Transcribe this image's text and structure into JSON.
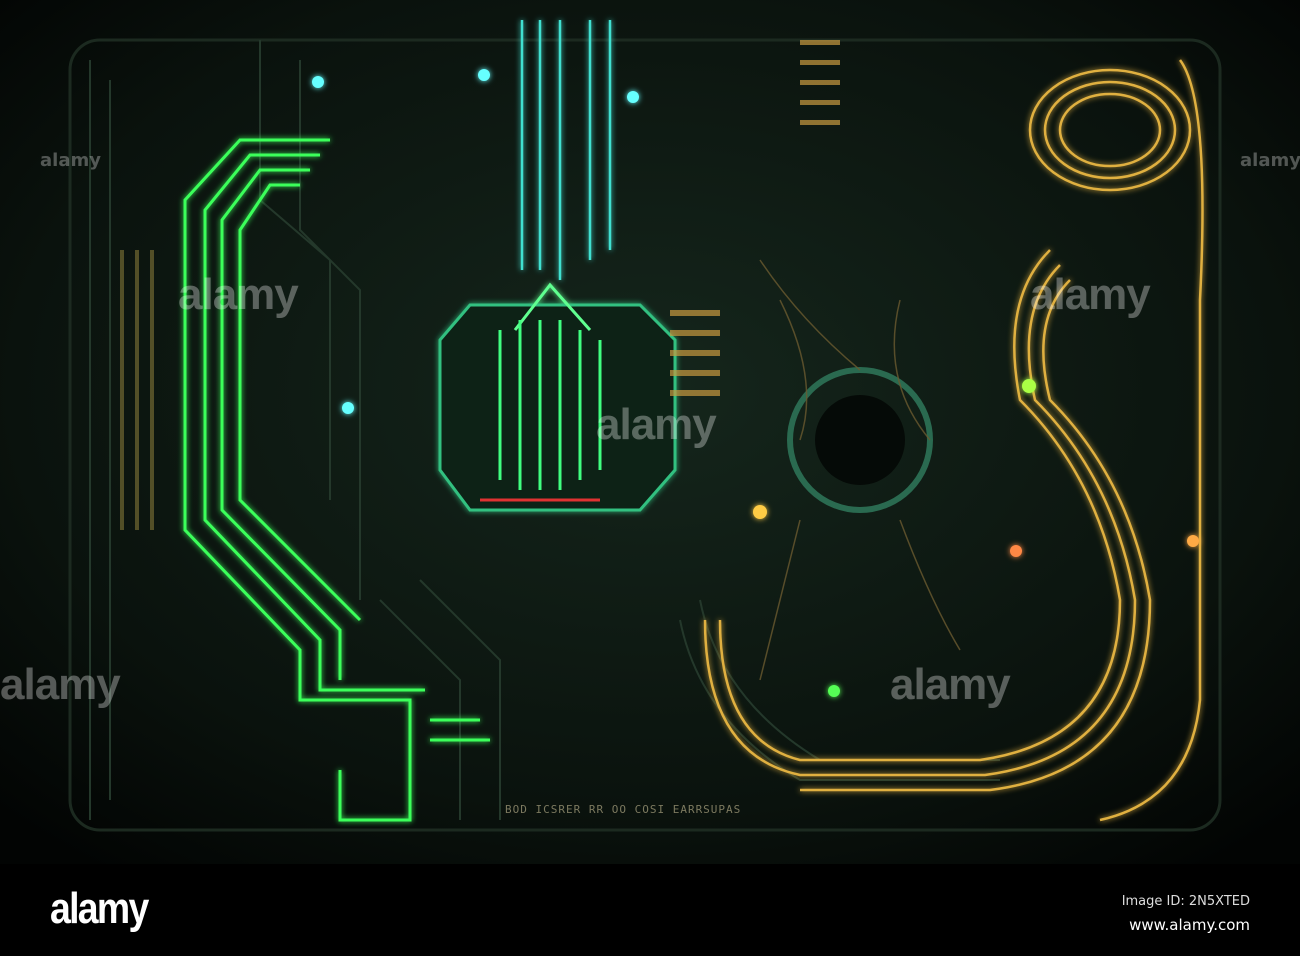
{
  "watermark": {
    "text": "alamy"
  },
  "board_label": "BOD ICSRER RR OO COSI EARRSUPAS",
  "footer": {
    "logo": "alamy",
    "image_id": "Image ID: 2N5XTED",
    "site": "www.alamy.com"
  },
  "colors": {
    "green": "#3bff5a",
    "cyan": "#40e0d0",
    "gold": "#e0b040",
    "background": "#0a120d"
  }
}
